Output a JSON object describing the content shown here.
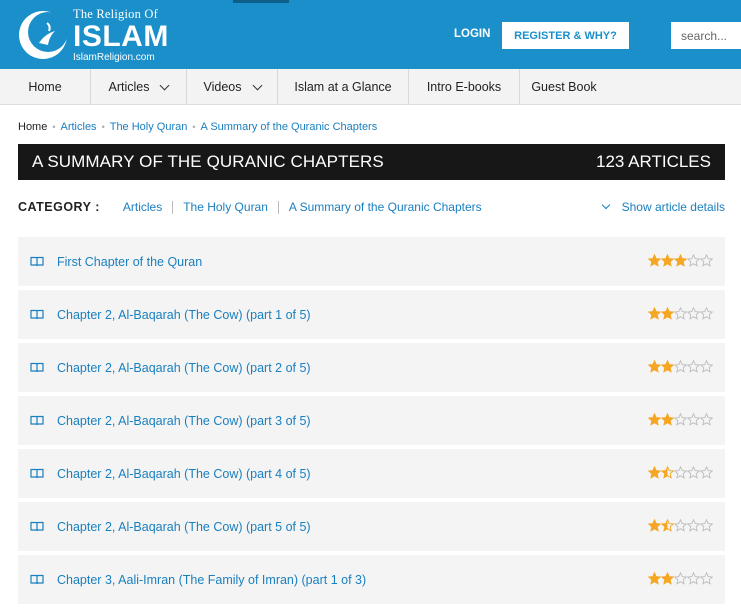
{
  "brand": {
    "line1": "The Religion Of",
    "line2": "ISLAM",
    "line3": "IslamReligion.com",
    "logo_icon": "crescent-logo-icon",
    "primary_color": "#1a8fc9"
  },
  "header": {
    "login_label": "LOGIN",
    "register_label": "REGISTER & WHY?",
    "search_placeholder": "search..."
  },
  "nav": {
    "items": [
      {
        "label": "Home",
        "has_dropdown": false
      },
      {
        "label": "Articles",
        "has_dropdown": true
      },
      {
        "label": "Videos",
        "has_dropdown": true
      },
      {
        "label": "Islam at a Glance",
        "has_dropdown": false
      },
      {
        "label": "Intro E-books",
        "has_dropdown": false
      },
      {
        "label": "Guest Book",
        "has_dropdown": false
      }
    ]
  },
  "breadcrumb": {
    "home": "Home",
    "items": [
      "Articles",
      "The Holy Quran",
      "A Summary of the Quranic Chapters"
    ]
  },
  "page": {
    "title": "A SUMMARY OF THE QURANIC CHAPTERS",
    "count": "123 ARTICLES"
  },
  "category": {
    "label": "CATEGORY :",
    "links": [
      "Articles",
      "The Holy Quran",
      "A Summary of the Quranic Chapters"
    ],
    "details_label": "Show article details"
  },
  "articles": [
    {
      "title": "First Chapter of the Quran",
      "rating": 3
    },
    {
      "title": "Chapter 2, Al-Baqarah (The Cow) (part 1 of 5)",
      "rating": 2
    },
    {
      "title": "Chapter 2, Al-Baqarah (The Cow) (part 2 of 5)",
      "rating": 2
    },
    {
      "title": "Chapter 2, Al-Baqarah (The Cow) (part 3 of 5)",
      "rating": 2
    },
    {
      "title": "Chapter 2, Al-Baqarah (The Cow) (part 4 of 5)",
      "rating": 1.5
    },
    {
      "title": "Chapter 2, Al-Baqarah (The Cow) (part 5 of 5)",
      "rating": 1.5
    },
    {
      "title": "Chapter 3, Aali-Imran (The Family of Imran) (part 1 of 3)",
      "rating": 2
    }
  ],
  "rating_max": 5,
  "colors": {
    "star_fill": "#f5a623",
    "star_empty": "#bdbdbd",
    "link": "#1a7fbf"
  }
}
